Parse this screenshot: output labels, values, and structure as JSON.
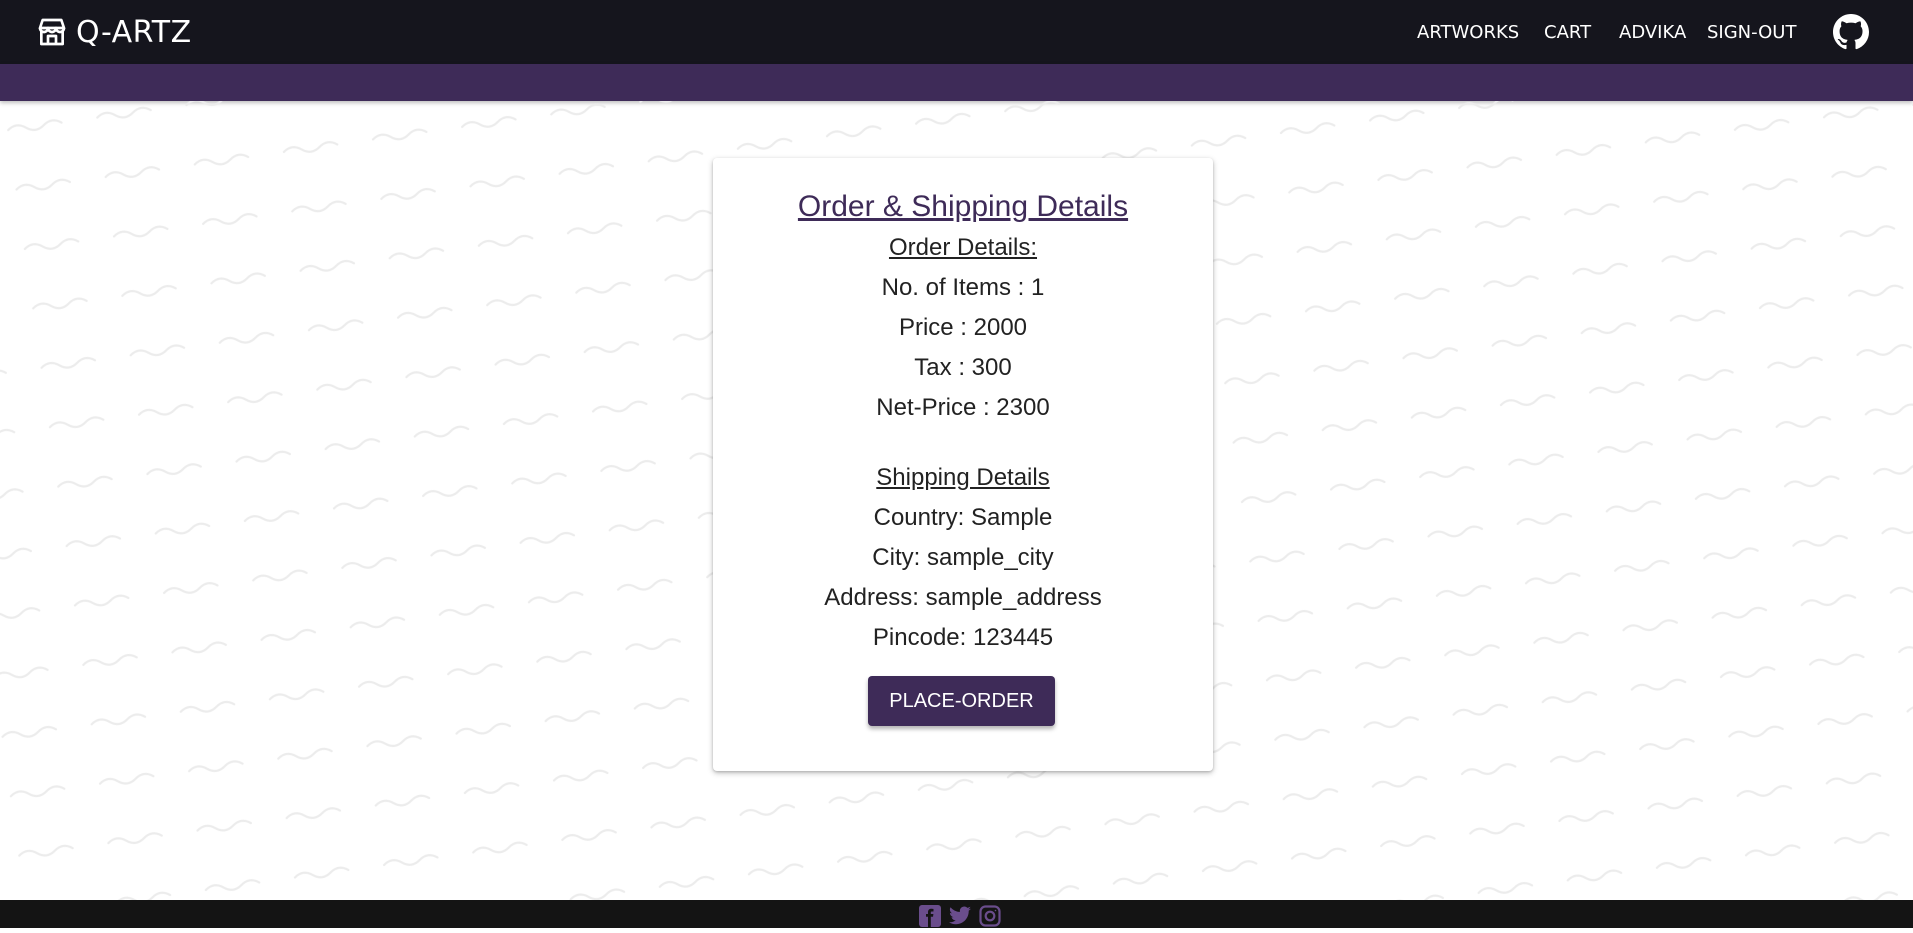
{
  "header": {
    "brand": "Q-ARTZ",
    "nav": {
      "artworks": "ARTWORKS",
      "cart": "CART",
      "user": "ADVIKA",
      "signout": "SIGN-OUT"
    },
    "icons": [
      "store-icon",
      "github-icon"
    ]
  },
  "colors": {
    "topbar": "#15151d",
    "accent": "#3e2b58",
    "footer": "#141414"
  },
  "card": {
    "title": "Order & Shipping Details",
    "order_heading": "Order Details:",
    "order_lines": [
      "No. of Items : 1",
      "Price : 2000",
      "Tax : 300",
      "Net-Price : 2300"
    ],
    "shipping_heading": "Shipping Details",
    "shipping_lines": [
      "Country: Sample",
      "City: sample_city",
      "Address: sample_address",
      "Pincode: 123445"
    ],
    "button": "PLACE-ORDER"
  },
  "footer": {
    "icons": [
      "facebook-icon",
      "twitter-icon",
      "instagram-icon"
    ]
  }
}
